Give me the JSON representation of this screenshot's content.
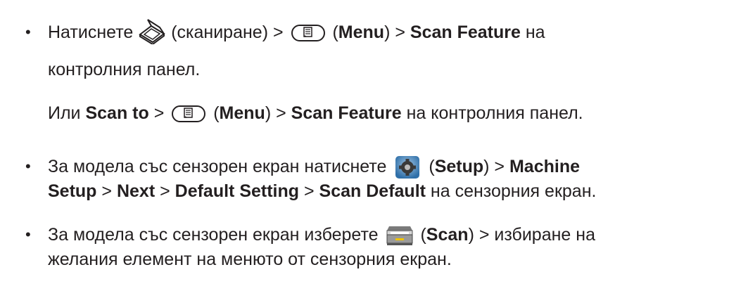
{
  "bullets": [
    {
      "line1": {
        "t1": "Натиснете ",
        "t2": "(сканиране) > ",
        "t3": " (",
        "menu": "Menu",
        "t4": ") > ",
        "feature": "Scan Feature",
        "t5": " на"
      },
      "line2": "контролния панел.",
      "line3": {
        "t1": "Или ",
        "scan_to": "Scan to",
        "t2": " > ",
        "t3": " (",
        "menu": "Menu",
        "t4": ") > ",
        "feature": "Scan Feature",
        "t5": " на контролния панел."
      }
    },
    {
      "line1": {
        "t1": "За модела със сензорен екран натиснете ",
        "t2": " (",
        "setup": "Setup",
        "t3": ") > ",
        "machine": "Machine"
      },
      "line2": {
        "setup_word": "Setup",
        "t1": " > ",
        "next": "Next",
        "t2": " > ",
        "default_setting": "Default Setting",
        "t3": " > ",
        "scan_default": "Scan Default",
        "t4": " на сензорния екран."
      }
    },
    {
      "line1": {
        "t1": "За модела със сензорен екран изберете ",
        "t2": " (",
        "scan": "Scan",
        "t3": ") > избиране на"
      },
      "line2": "желания елемент на менюто от сензорния екран."
    }
  ],
  "icons": {
    "scan": "scanner-outline-icon",
    "menu": "menu-key-icon",
    "setup": "gear-icon",
    "touch_scan": "flatbed-scanner-icon"
  }
}
